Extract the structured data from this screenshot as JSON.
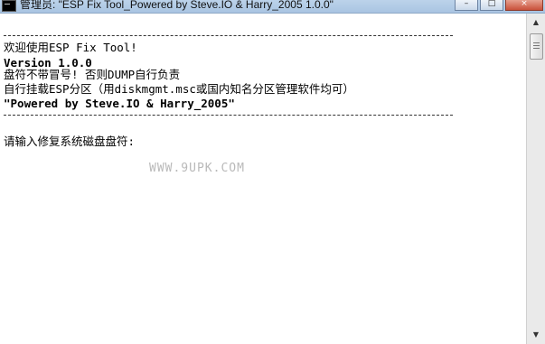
{
  "window": {
    "title": "管理员: \"ESP Fix Tool_Powered by Steve.IO & Harry_2005 1.0.0\"",
    "buttons": {
      "minimize": "–",
      "maximize": "□",
      "close": "×"
    }
  },
  "console": {
    "lines": [
      "欢迎使用ESP Fix Tool!",
      "Version 1.0.0",
      "盘符不带冒号! 否则DUMP自行负责",
      "自行挂载ESP分区（用diskmgmt.msc或国内知名分区管理软件均可）",
      "\"Powered by Steve.IO & Harry_2005\""
    ],
    "prompt": "请输入修复系统磁盘盘符:"
  },
  "watermark": "WWW.9UPK.COM",
  "scrollbar": {
    "up_arrow": "▲",
    "down_arrow": "▼"
  }
}
